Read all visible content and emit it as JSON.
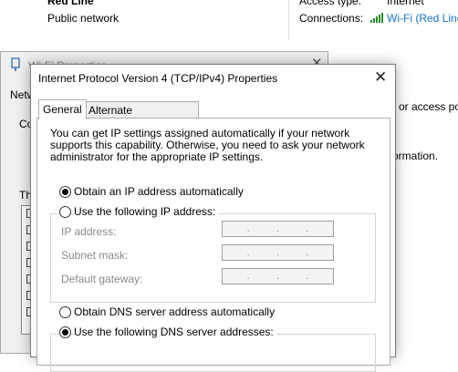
{
  "background": {
    "network_name": "Red Line",
    "network_type": "Public network",
    "access_type_label": "Access type:",
    "access_type_value": "Internet",
    "connections_label": "Connections:",
    "connection_link": "Wi-Fi (Red Line",
    "partial_text_1": "or access po",
    "partial_text_2": "ormation."
  },
  "wifi_properties": {
    "title": "Wi-Fi Properties",
    "tab_partial": "Netw",
    "label_partial_1": "Co",
    "label_partial_2": "Th"
  },
  "ipv4": {
    "title": "Internet Protocol Version 4 (TCP/IPv4) Properties",
    "close_glyph": "✕",
    "tabs": [
      "General",
      "Alternate Configuration"
    ],
    "intro": "You can get IP settings assigned automatically if your network supports this capability. Otherwise, you need to ask your network administrator for the appropriate IP settings.",
    "ip_auto_label": "Obtain an IP address automatically",
    "ip_manual_label": "Use the following IP address:",
    "ip_address_label": "IP address:",
    "subnet_label": "Subnet mask:",
    "gateway_label": "Default gateway:",
    "ip_placeholder": ".   .   .",
    "dns_auto_label": "Obtain DNS server address automatically",
    "dns_manual_label": "Use the following DNS server addresses:",
    "ip_mode": "auto",
    "dns_mode": "manual"
  },
  "colors": {
    "link": "#1a73c9",
    "signal": "#2e8b2e"
  }
}
